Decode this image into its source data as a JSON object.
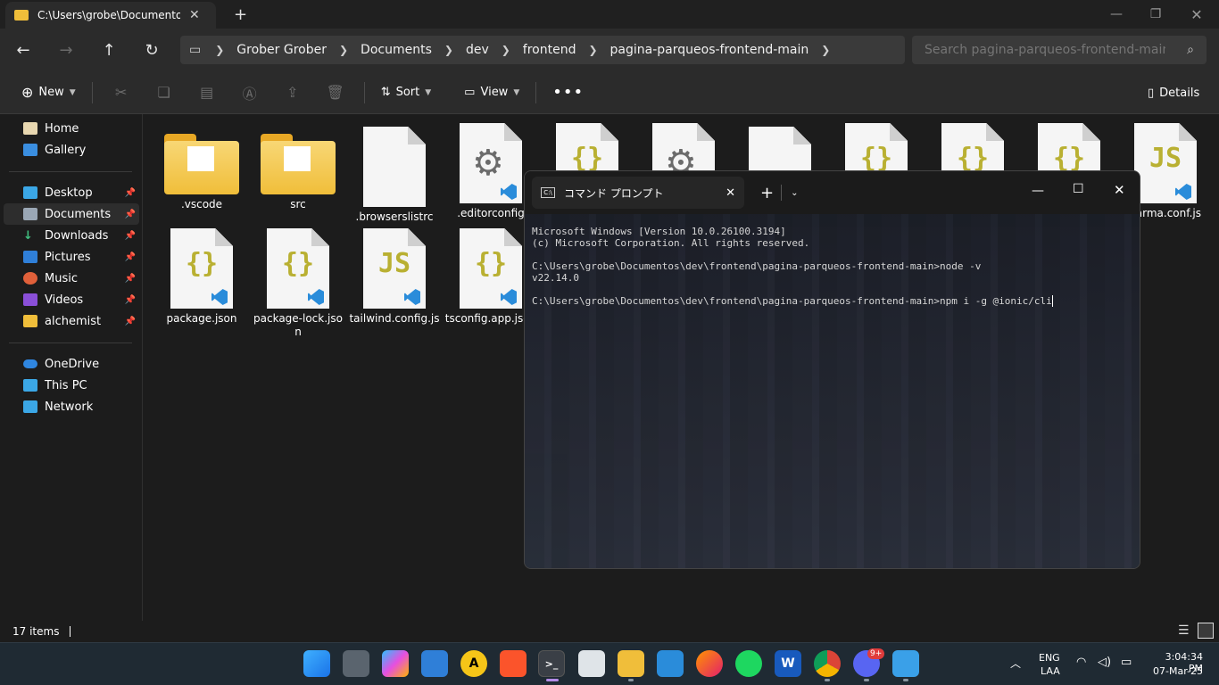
{
  "explorer": {
    "tab_title": "C:\\Users\\grobe\\Documentos\\d",
    "breadcrumbs": [
      "Grober Grober",
      "Documents",
      "dev",
      "frontend",
      "pagina-parqueos-frontend-main"
    ],
    "search_placeholder": "Search pagina-parqueos-frontend-main",
    "toolbar": {
      "new_label": "New",
      "sort_label": "Sort",
      "view_label": "View",
      "details_label": "Details"
    },
    "sidebar": {
      "top": [
        {
          "label": "Home"
        },
        {
          "label": "Gallery"
        }
      ],
      "pinned": [
        {
          "label": "Desktop"
        },
        {
          "label": "Documents"
        },
        {
          "label": "Downloads"
        },
        {
          "label": "Pictures"
        },
        {
          "label": "Music"
        },
        {
          "label": "Videos"
        },
        {
          "label": "alchemist"
        }
      ],
      "bottom": [
        {
          "label": "OneDrive"
        },
        {
          "label": "This PC"
        },
        {
          "label": "Network"
        }
      ]
    },
    "files": [
      {
        "name": ".vscode",
        "type": "folder"
      },
      {
        "name": "src",
        "type": "folder"
      },
      {
        "name": ".browserslistrc",
        "type": "blank"
      },
      {
        "name": ".editorconfig",
        "type": "gear"
      },
      {
        "name": "karma.conf.js",
        "type": "js"
      },
      {
        "name": "package.json",
        "type": "json"
      },
      {
        "name": "package-lock.json",
        "type": "json"
      },
      {
        "name": "tailwind.config.js",
        "type": "js"
      },
      {
        "name": "tsconfig.app.json",
        "type": "json"
      }
    ],
    "status": {
      "items_count": "17 items"
    }
  },
  "terminal": {
    "tab_title": "コマンド プロンプト",
    "lines": [
      "Microsoft Windows [Version 10.0.26100.3194]",
      "(c) Microsoft Corporation. All rights reserved.",
      "",
      "C:\\Users\\grobe\\Documentos\\dev\\frontend\\pagina-parqueos-frontend-main>node -v",
      "v22.14.0",
      "",
      "C:\\Users\\grobe\\Documentos\\dev\\frontend\\pagina-parqueos-frontend-main>npm i -g @ionic/cli"
    ]
  },
  "taskbar": {
    "language": "ENG",
    "layout": "LAA",
    "time": "3:04:34 PM",
    "date": "07-Mar-25",
    "discord_badge": "9+"
  }
}
